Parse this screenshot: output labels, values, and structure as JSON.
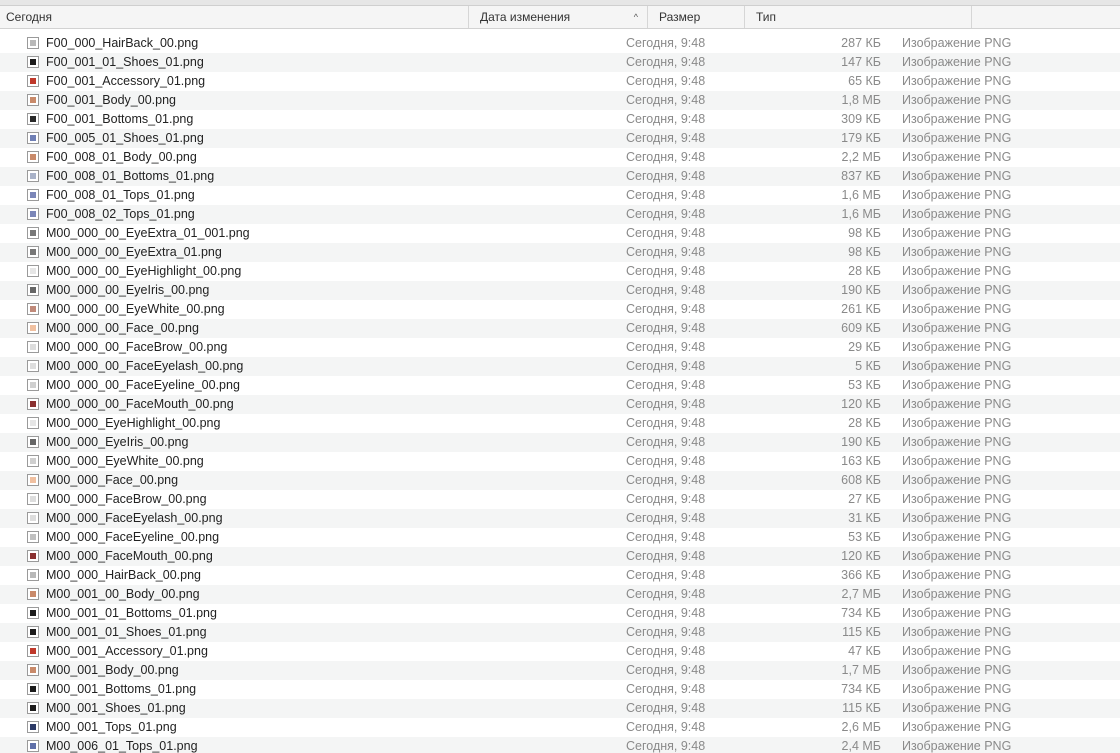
{
  "header": {
    "name_label": "Сегодня",
    "date_label": "Дата изменения",
    "size_label": "Размер",
    "type_label": "Тип",
    "sort_indicator": "^"
  },
  "rows": [
    {
      "name": "F00_000_HairBack_00.png",
      "date": "Сегодня, 9:48",
      "size": "287 КБ",
      "type": "Изображение PNG",
      "icon": "hair-thumb-icon",
      "color": "#b8b8b8"
    },
    {
      "name": "F00_001_01_Shoes_01.png",
      "date": "Сегодня, 9:48",
      "size": "147 КБ",
      "type": "Изображение PNG",
      "icon": "shoes-thumb-icon",
      "color": "#1c1c1c"
    },
    {
      "name": "F00_001_Accessory_01.png",
      "date": "Сегодня, 9:48",
      "size": "65 КБ",
      "type": "Изображение PNG",
      "icon": "accessory-thumb-icon",
      "color": "#c0392b"
    },
    {
      "name": "F00_001_Body_00.png",
      "date": "Сегодня, 9:48",
      "size": "1,8 МБ",
      "type": "Изображение PNG",
      "icon": "body-thumb-icon",
      "color": "#c98a6a"
    },
    {
      "name": "F00_001_Bottoms_01.png",
      "date": "Сегодня, 9:48",
      "size": "309 КБ",
      "type": "Изображение PNG",
      "icon": "bottoms-thumb-icon",
      "color": "#2a2a2a"
    },
    {
      "name": "F00_005_01_Shoes_01.png",
      "date": "Сегодня, 9:48",
      "size": "179 КБ",
      "type": "Изображение PNG",
      "icon": "shoes-thumb-icon",
      "color": "#6f7fb5"
    },
    {
      "name": "F00_008_01_Body_00.png",
      "date": "Сегодня, 9:48",
      "size": "2,2 МБ",
      "type": "Изображение PNG",
      "icon": "body-thumb-icon",
      "color": "#c98a6a"
    },
    {
      "name": "F00_008_01_Bottoms_01.png",
      "date": "Сегодня, 9:48",
      "size": "837 КБ",
      "type": "Изображение PNG",
      "icon": "bottoms-thumb-icon",
      "color": "#a9b2c8"
    },
    {
      "name": "F00_008_01_Tops_01.png",
      "date": "Сегодня, 9:48",
      "size": "1,6 МБ",
      "type": "Изображение PNG",
      "icon": "tops-thumb-icon",
      "color": "#7b86b8"
    },
    {
      "name": "F00_008_02_Tops_01.png",
      "date": "Сегодня, 9:48",
      "size": "1,6 МБ",
      "type": "Изображение PNG",
      "icon": "tops-thumb-icon",
      "color": "#7b86b8"
    },
    {
      "name": "M00_000_00_EyeExtra_01_001.png",
      "date": "Сегодня, 9:48",
      "size": "98 КБ",
      "type": "Изображение PNG",
      "icon": "eye-thumb-icon",
      "color": "#777777"
    },
    {
      "name": "M00_000_00_EyeExtra_01.png",
      "date": "Сегодня, 9:48",
      "size": "98 КБ",
      "type": "Изображение PNG",
      "icon": "eye-thumb-icon",
      "color": "#777777"
    },
    {
      "name": "M00_000_00_EyeHighlight_00.png",
      "date": "Сегодня, 9:48",
      "size": "28 КБ",
      "type": "Изображение PNG",
      "icon": "eye-thumb-icon",
      "color": "#e6e6e6"
    },
    {
      "name": "M00_000_00_EyeIris_00.png",
      "date": "Сегодня, 9:48",
      "size": "190 КБ",
      "type": "Изображение PNG",
      "icon": "eye-thumb-icon",
      "color": "#666666"
    },
    {
      "name": "M00_000_00_EyeWhite_00.png",
      "date": "Сегодня, 9:48",
      "size": "261 КБ",
      "type": "Изображение PNG",
      "icon": "eye-thumb-icon",
      "color": "#c08a7a"
    },
    {
      "name": "M00_000_00_Face_00.png",
      "date": "Сегодня, 9:48",
      "size": "609 КБ",
      "type": "Изображение PNG",
      "icon": "face-thumb-icon",
      "color": "#f0c0a0"
    },
    {
      "name": "M00_000_00_FaceBrow_00.png",
      "date": "Сегодня, 9:48",
      "size": "29 КБ",
      "type": "Изображение PNG",
      "icon": "face-thumb-icon",
      "color": "#dddddd"
    },
    {
      "name": "M00_000_00_FaceEyelash_00.png",
      "date": "Сегодня, 9:48",
      "size": "5 КБ",
      "type": "Изображение PNG",
      "icon": "face-thumb-icon",
      "color": "#dddddd"
    },
    {
      "name": "M00_000_00_FaceEyeline_00.png",
      "date": "Сегодня, 9:48",
      "size": "53 КБ",
      "type": "Изображение PNG",
      "icon": "face-thumb-icon",
      "color": "#d0d0d0"
    },
    {
      "name": "M00_000_00_FaceMouth_00.png",
      "date": "Сегодня, 9:48",
      "size": "120 КБ",
      "type": "Изображение PNG",
      "icon": "mouth-thumb-icon",
      "color": "#8a3030"
    },
    {
      "name": "M00_000_EyeHighlight_00.png",
      "date": "Сегодня, 9:48",
      "size": "28 КБ",
      "type": "Изображение PNG",
      "icon": "eye-thumb-icon",
      "color": "#e6e6e6"
    },
    {
      "name": "M00_000_EyeIris_00.png",
      "date": "Сегодня, 9:48",
      "size": "190 КБ",
      "type": "Изображение PNG",
      "icon": "eye-thumb-icon",
      "color": "#666666"
    },
    {
      "name": "M00_000_EyeWhite_00.png",
      "date": "Сегодня, 9:48",
      "size": "163 КБ",
      "type": "Изображение PNG",
      "icon": "eye-thumb-icon",
      "color": "#cfcfcf"
    },
    {
      "name": "M00_000_Face_00.png",
      "date": "Сегодня, 9:48",
      "size": "608 КБ",
      "type": "Изображение PNG",
      "icon": "face-thumb-icon",
      "color": "#f0c0a0"
    },
    {
      "name": "M00_000_FaceBrow_00.png",
      "date": "Сегодня, 9:48",
      "size": "27 КБ",
      "type": "Изображение PNG",
      "icon": "face-thumb-icon",
      "color": "#dddddd"
    },
    {
      "name": "M00_000_FaceEyelash_00.png",
      "date": "Сегодня, 9:48",
      "size": "31 КБ",
      "type": "Изображение PNG",
      "icon": "face-thumb-icon",
      "color": "#dddddd"
    },
    {
      "name": "M00_000_FaceEyeline_00.png",
      "date": "Сегодня, 9:48",
      "size": "53 КБ",
      "type": "Изображение PNG",
      "icon": "face-thumb-icon",
      "color": "#c0c0c0"
    },
    {
      "name": "M00_000_FaceMouth_00.png",
      "date": "Сегодня, 9:48",
      "size": "120 КБ",
      "type": "Изображение PNG",
      "icon": "mouth-thumb-icon",
      "color": "#8a3030"
    },
    {
      "name": "M00_000_HairBack_00.png",
      "date": "Сегодня, 9:48",
      "size": "366 КБ",
      "type": "Изображение PNG",
      "icon": "hair-thumb-icon",
      "color": "#b8b8b8"
    },
    {
      "name": "M00_001_00_Body_00.png",
      "date": "Сегодня, 9:48",
      "size": "2,7 МБ",
      "type": "Изображение PNG",
      "icon": "body-thumb-icon",
      "color": "#c98a6a"
    },
    {
      "name": "M00_001_01_Bottoms_01.png",
      "date": "Сегодня, 9:48",
      "size": "734 КБ",
      "type": "Изображение PNG",
      "icon": "bottoms-thumb-icon",
      "color": "#1c1c1c"
    },
    {
      "name": "M00_001_01_Shoes_01.png",
      "date": "Сегодня, 9:48",
      "size": "115 КБ",
      "type": "Изображение PNG",
      "icon": "shoes-thumb-icon",
      "color": "#1c1c1c"
    },
    {
      "name": "M00_001_Accessory_01.png",
      "date": "Сегодня, 9:48",
      "size": "47 КБ",
      "type": "Изображение PNG",
      "icon": "accessory-thumb-icon",
      "color": "#c0392b"
    },
    {
      "name": "M00_001_Body_00.png",
      "date": "Сегодня, 9:48",
      "size": "1,7 МБ",
      "type": "Изображение PNG",
      "icon": "body-thumb-icon",
      "color": "#c98a6a"
    },
    {
      "name": "M00_001_Bottoms_01.png",
      "date": "Сегодня, 9:48",
      "size": "734 КБ",
      "type": "Изображение PNG",
      "icon": "bottoms-thumb-icon",
      "color": "#1c1c1c"
    },
    {
      "name": "M00_001_Shoes_01.png",
      "date": "Сегодня, 9:48",
      "size": "115 КБ",
      "type": "Изображение PNG",
      "icon": "shoes-thumb-icon",
      "color": "#1c1c1c"
    },
    {
      "name": "M00_001_Tops_01.png",
      "date": "Сегодня, 9:48",
      "size": "2,6 МБ",
      "type": "Изображение PNG",
      "icon": "tops-thumb-icon",
      "color": "#2c3a66"
    },
    {
      "name": "M00_006_01_Tops_01.png",
      "date": "Сегодня, 9:48",
      "size": "2,4 МБ",
      "type": "Изображение PNG",
      "icon": "tops-thumb-icon",
      "color": "#5f6fa8"
    }
  ]
}
